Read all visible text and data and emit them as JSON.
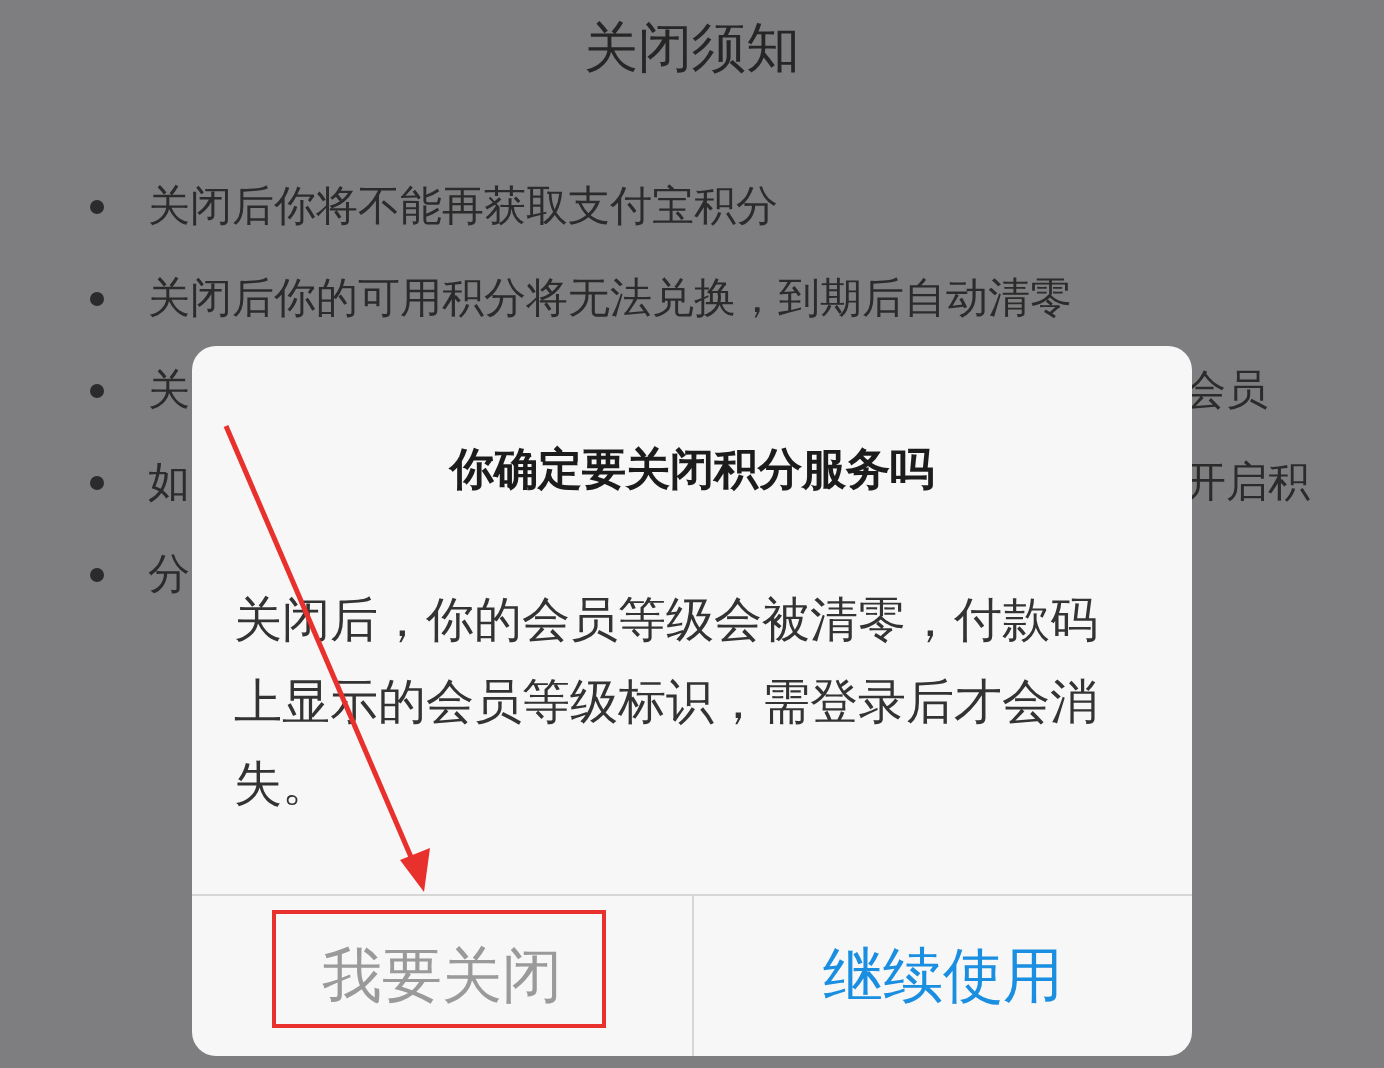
{
  "page": {
    "title": "关闭须知"
  },
  "notice_items": [
    {
      "parts": [
        "关闭后你将不能再获取支付宝积分"
      ]
    },
    {
      "parts": [
        "关闭后你的可用积分将无法兑换，到期后自动清零"
      ]
    },
    {
      "parts": [
        "关",
        "会员"
      ]
    },
    {
      "parts": [
        "如",
        "开启积"
      ]
    },
    {
      "parts": [
        "分"
      ]
    }
  ],
  "dialog": {
    "title": "你确定要关闭积分服务吗",
    "message": "关闭后，你的会员等级会被清零，付款码上显示的会员等级标识，需登录后才会消失。",
    "buttons": [
      {
        "label": "我要关闭",
        "kind": "cancel"
      },
      {
        "label": "继续使用",
        "kind": "confirm"
      }
    ]
  }
}
